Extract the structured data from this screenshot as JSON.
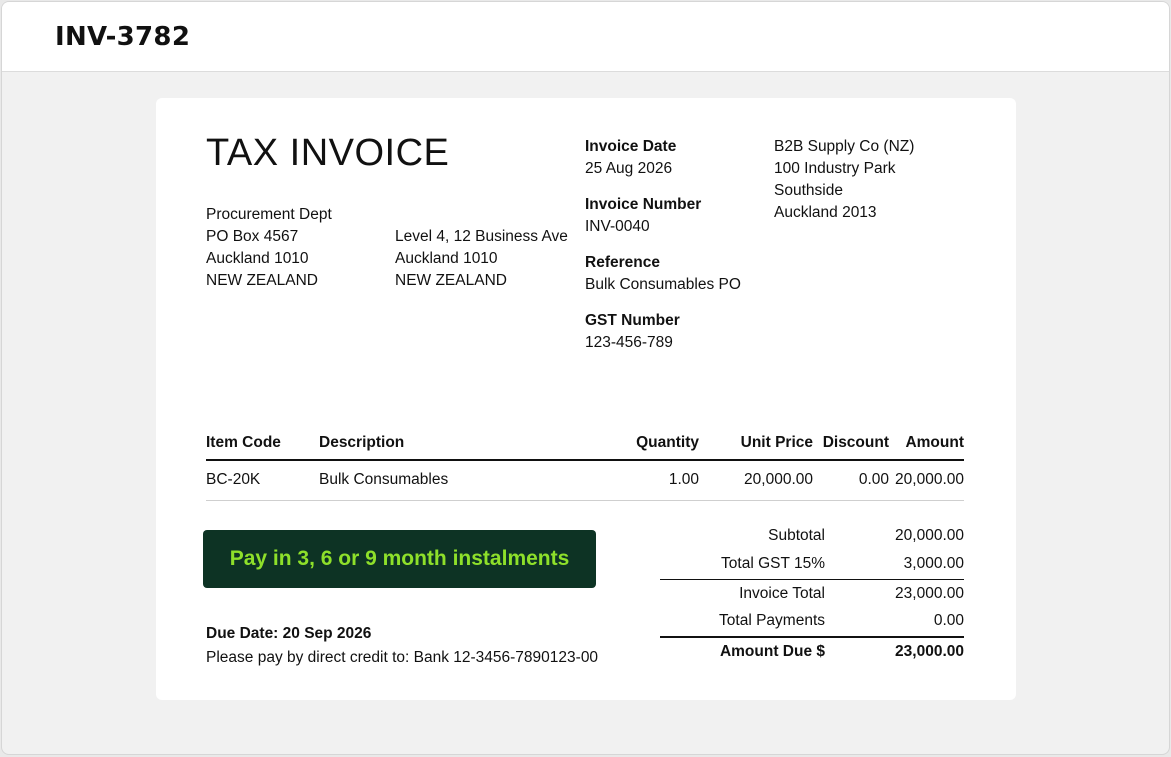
{
  "window": {
    "title": "INV-3782"
  },
  "invoice": {
    "heading": "TAX INVOICE",
    "bill_to": [
      "Procurement Dept",
      "PO Box 4567",
      "Auckland 1010",
      "NEW ZEALAND"
    ],
    "ship_to": [
      "Level 4, 12 Business Ave",
      "Auckland 1010",
      "NEW ZEALAND"
    ],
    "meta": [
      {
        "label": "Invoice Date",
        "value": "25 Aug 2026"
      },
      {
        "label": "Invoice Number",
        "value": "INV-0040"
      },
      {
        "label": "Reference",
        "value": "Bulk Consumables PO"
      },
      {
        "label": "GST Number",
        "value": "123-456-789"
      }
    ],
    "supplier": [
      "B2B Supply Co (NZ)",
      "100 Industry Park",
      "Southside",
      "Auckland 2013"
    ],
    "columns": {
      "item_code": "Item Code",
      "description": "Description",
      "quantity": "Quantity",
      "unit_price": "Unit Price",
      "discount": "Discount",
      "amount": "Amount"
    },
    "items": [
      {
        "item_code": "BC-20K",
        "description": "Bulk Consumables",
        "quantity": "1.00",
        "unit_price": "20,000.00",
        "discount": "0.00",
        "amount": "20,000.00"
      }
    ],
    "promo": "Pay in 3, 6 or 9 month instalments",
    "totals": {
      "subtotal_label": "Subtotal",
      "subtotal": "20,000.00",
      "gst_label": "Total GST 15%",
      "gst": "3,000.00",
      "total_label": "Invoice Total",
      "total": "23,000.00",
      "payments_label": "Total Payments",
      "payments": "0.00",
      "due_label": "Amount Due $",
      "due": "23,000.00"
    },
    "due_date": "Due Date: 20 Sep 2026",
    "payment_note": "Please pay by direct credit to: Bank 12-3456-7890123-00"
  },
  "colors": {
    "promo_bg": "#0d3324",
    "promo_text": "#8ee02a"
  }
}
